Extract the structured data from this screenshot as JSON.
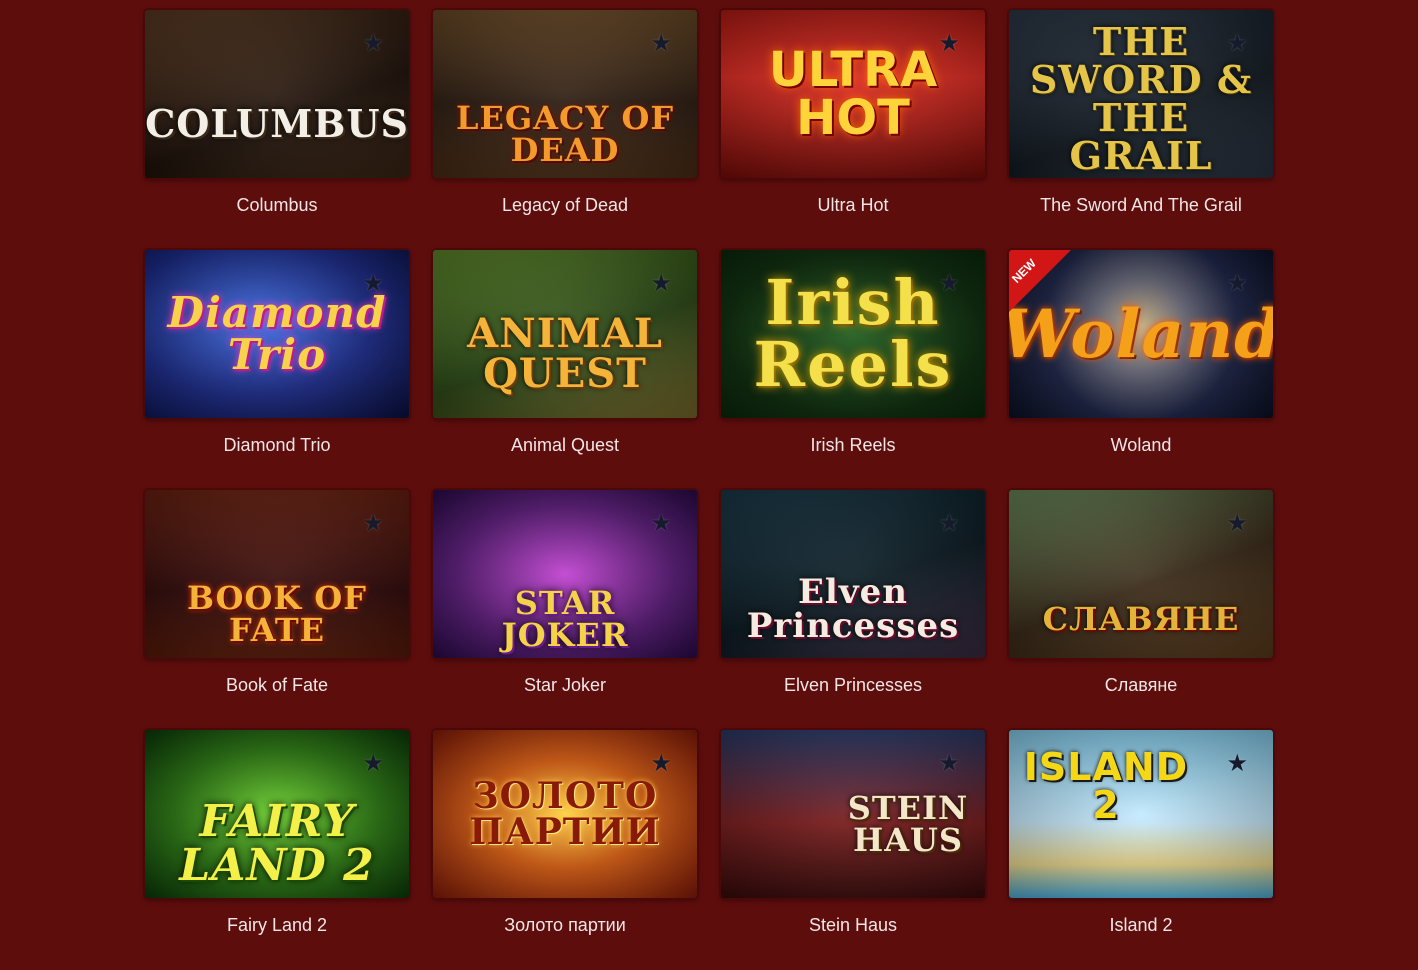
{
  "games": [
    {
      "title": "Columbus",
      "logo": "Columbus",
      "art": "g-columbus",
      "is_new": false
    },
    {
      "title": "Legacy of Dead",
      "logo": "Legacy of Dead",
      "art": "g-legacy",
      "is_new": false
    },
    {
      "title": "Ultra Hot",
      "logo": "Ultra Hot",
      "art": "g-ultra",
      "is_new": false
    },
    {
      "title": "The Sword And The Grail",
      "logo": "The Sword & The Grail",
      "art": "g-sword",
      "is_new": false
    },
    {
      "title": "Diamond Trio",
      "logo": "Diamond Trio",
      "art": "g-diamond",
      "is_new": false
    },
    {
      "title": "Animal Quest",
      "logo": "Animal Quest",
      "art": "g-animal",
      "is_new": false
    },
    {
      "title": "Irish Reels",
      "logo": "Irish Reels",
      "art": "g-irish",
      "is_new": false
    },
    {
      "title": "Woland",
      "logo": "Woland",
      "art": "g-woland",
      "is_new": true,
      "badge": "NEW"
    },
    {
      "title": "Book of Fate",
      "logo": "Book of Fate",
      "art": "g-bookfate",
      "is_new": false
    },
    {
      "title": "Star Joker",
      "logo": "Star Joker",
      "art": "g-starjoker",
      "is_new": false
    },
    {
      "title": "Elven Princesses",
      "logo": "Elven Princesses",
      "art": "g-elven",
      "is_new": false
    },
    {
      "title": "Славяне",
      "logo": "Славяне",
      "art": "g-slav",
      "is_new": false
    },
    {
      "title": "Fairy Land 2",
      "logo": "Fairy Land 2",
      "art": "g-fairy",
      "is_new": false
    },
    {
      "title": "Золото партии",
      "logo": "Золото партии",
      "art": "g-zoloto",
      "is_new": false
    },
    {
      "title": "Stein Haus",
      "logo": "Stein Haus",
      "art": "g-stein",
      "is_new": false
    },
    {
      "title": "Island 2",
      "logo": "Island 2",
      "art": "g-island",
      "is_new": false
    }
  ],
  "favorite_icon": "star-icon",
  "colors": {
    "background": "#5e0d0d",
    "title_text": "#f1e6e6",
    "favorite_star": "#151b2c",
    "new_badge": "#d21616"
  }
}
